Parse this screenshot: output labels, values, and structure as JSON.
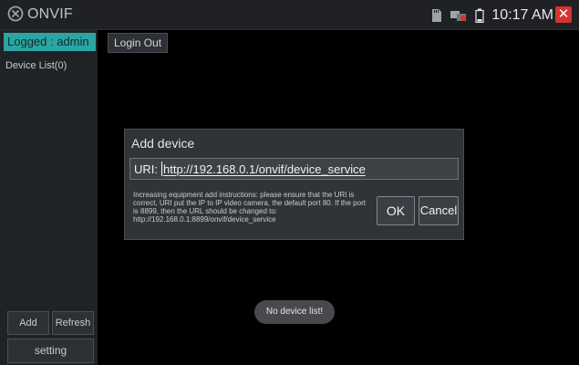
{
  "app": {
    "title": "ONVIF"
  },
  "statusbar": {
    "time": "10:17 AM"
  },
  "sidebar": {
    "logged": "Logged : admin",
    "device_list": "Device List(0)",
    "add": "Add",
    "refresh": "Refresh",
    "setting": "setting"
  },
  "main": {
    "logout": "Login Out"
  },
  "dialog": {
    "title": "Add device",
    "uri_label": "URI:",
    "uri_value": "http://192.168.0.1/onvif/device_service",
    "instructions": "Increasing equipment add instructions: please ensure that the URI is correct, URI put the IP to IP video camera, the default port 80. If the port is 8899, then the URL should be changed to: http://192.168.0.1:8899/onvif/device_service",
    "ok": "OK",
    "cancel": "Cancel"
  },
  "toast": "No device list!",
  "colors": {
    "accent": "#2aa5a3",
    "close": "#d3342f"
  }
}
